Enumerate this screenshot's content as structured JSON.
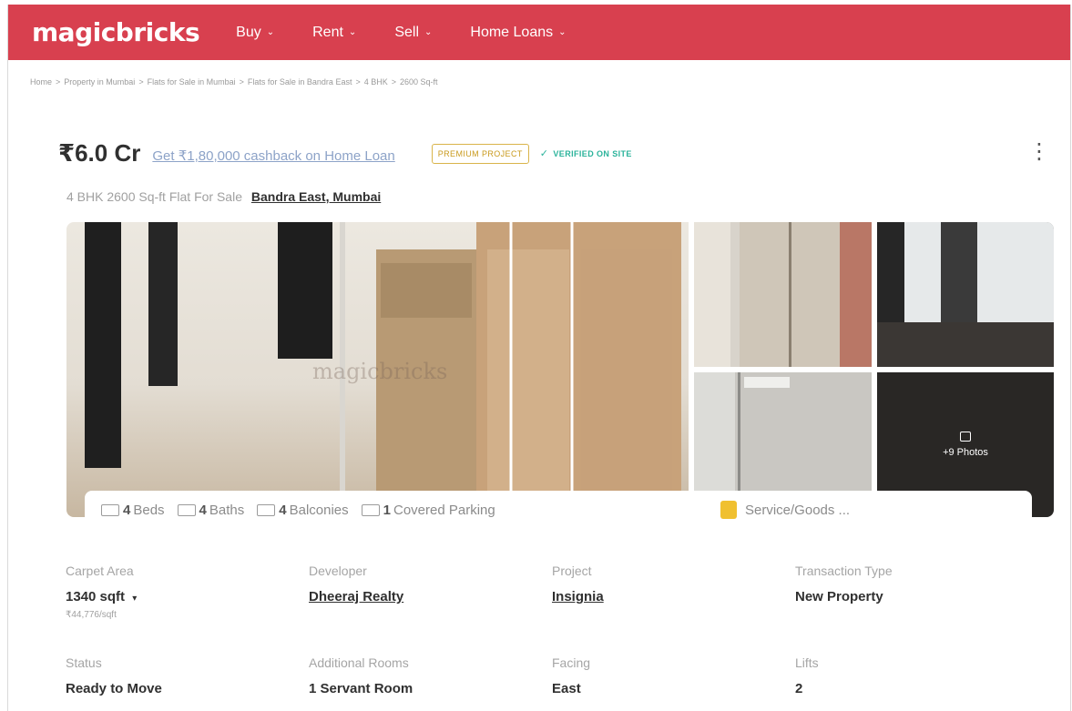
{
  "header": {
    "logo": "magicbricks",
    "nav": [
      {
        "label": "Buy"
      },
      {
        "label": "Rent"
      },
      {
        "label": "Sell"
      },
      {
        "label": "Home Loans"
      }
    ],
    "brand_color": "#d8404f"
  },
  "breadcrumb": [
    "Home",
    "Property in Mumbai",
    "Flats for Sale in Mumbai",
    "Flats for Sale in Bandra East",
    "4 BHK",
    "2600 Sq-ft"
  ],
  "listing": {
    "price": "₹6.0 Cr",
    "cashback": "Get ₹1,80,000 cashback on Home Loan",
    "badge": "PREMIUM PROJECT",
    "verified": "VERIFIED ON SITE",
    "subtitle": "4 BHK 2600 Sq-ft Flat For Sale",
    "location": "Bandra East, Mumbai"
  },
  "gallery": {
    "watermark": "magicbricks",
    "more_photos": "+9 Photos"
  },
  "amenities": [
    {
      "count": "4",
      "label": "Beds",
      "icon": "bed-icon"
    },
    {
      "count": "4",
      "label": "Baths",
      "icon": "bath-icon"
    },
    {
      "count": "4",
      "label": "Balconies",
      "icon": "balcony-icon"
    },
    {
      "count": "1",
      "label": "Covered Parking",
      "icon": "car-icon"
    }
  ],
  "service": "Service/Goods ...",
  "details": {
    "carpet_area": {
      "label": "Carpet Area",
      "value": "1340 sqft",
      "sub": "₹44,776/sqft"
    },
    "developer": {
      "label": "Developer",
      "value": "Dheeraj Realty"
    },
    "project": {
      "label": "Project",
      "value": "Insignia"
    },
    "transaction": {
      "label": "Transaction Type",
      "value": "New Property"
    },
    "status": {
      "label": "Status",
      "value": "Ready to Move"
    },
    "additional_rooms": {
      "label": "Additional Rooms",
      "value": "1 Servant Room"
    },
    "facing": {
      "label": "Facing",
      "value": "East"
    },
    "lifts": {
      "label": "Lifts",
      "value": "2"
    }
  }
}
